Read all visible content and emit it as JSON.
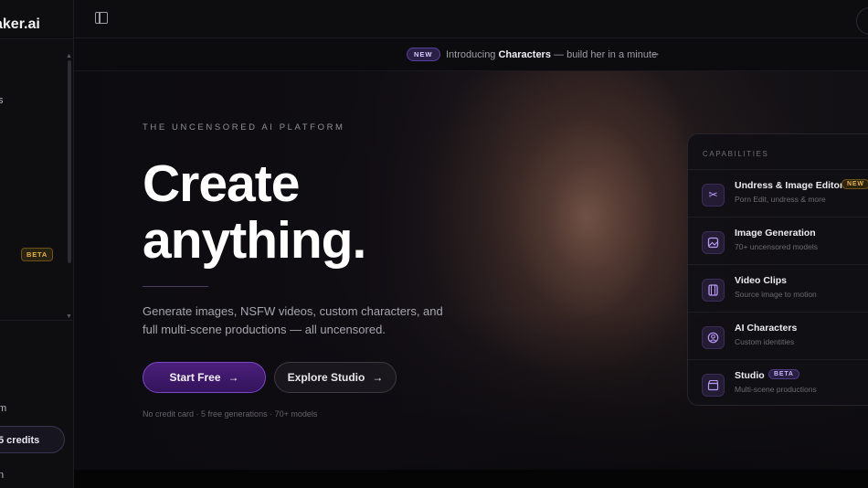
{
  "sidebar": {
    "brand": "aker.ai",
    "fragment_top": "s",
    "beta_badge": "BETA",
    "fragment_m": "m",
    "credits": "5 credits",
    "fragment_n": "n"
  },
  "announcement": {
    "badge": "NEW",
    "prefix": "Introducing ",
    "highlight": "Characters",
    "suffix": " — build her in a minute",
    "arrow": "→"
  },
  "hero": {
    "eyebrow": "THE UNCENSORED AI PLATFORM",
    "headline_line1": "Create",
    "headline_line2": "anything.",
    "lede": "Generate images, NSFW videos, custom characters, and full multi-scene productions — all uncensored.",
    "primary_cta": "Start Free",
    "secondary_cta": "Explore Studio",
    "fineprint": "No credit card · 5 free generations · 70+ models"
  },
  "capabilities": {
    "title": "CAPABILITIES",
    "items": [
      {
        "name": "Undress & Image Editor",
        "sub": "Porn Edit, undress & more",
        "tag": "NEW",
        "icon": "scissors-icon"
      },
      {
        "name": "Image Generation",
        "sub": "70+ uncensored models",
        "tag": "",
        "icon": "image-sparkle-icon"
      },
      {
        "name": "Video Clips",
        "sub": "Source image to motion",
        "tag": "",
        "icon": "film-icon"
      },
      {
        "name": "AI Characters",
        "sub": "Custom identities",
        "tag": "",
        "icon": "user-circle-icon"
      },
      {
        "name": "Studio",
        "sub": "Multi-scene productions",
        "tag": "BETA",
        "icon": "clapperboard-icon"
      }
    ]
  },
  "colors": {
    "accent": "#7a46c4",
    "primary_button": "#4a1f7a",
    "new_badge": "#e5b341",
    "background": "#0b0b0d"
  }
}
